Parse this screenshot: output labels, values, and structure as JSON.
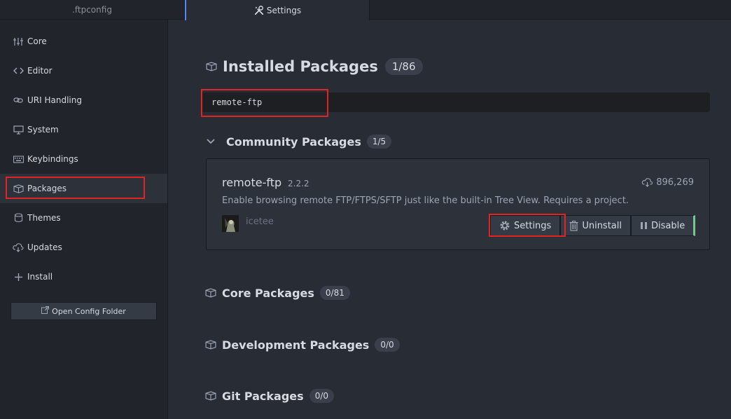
{
  "tabs": [
    {
      "label": ".ftpconfig"
    },
    {
      "label": "Settings"
    }
  ],
  "sidebar": {
    "items": [
      {
        "label": "Core",
        "icon": "sliders-icon"
      },
      {
        "label": "Editor",
        "icon": "code-icon"
      },
      {
        "label": "URI Handling",
        "icon": "link-icon"
      },
      {
        "label": "System",
        "icon": "monitor-icon"
      },
      {
        "label": "Keybindings",
        "icon": "keyboard-icon"
      },
      {
        "label": "Packages",
        "icon": "package-icon"
      },
      {
        "label": "Themes",
        "icon": "paintcan-icon"
      },
      {
        "label": "Updates",
        "icon": "cloud-download-icon"
      },
      {
        "label": "Install",
        "icon": "plus-icon"
      }
    ],
    "active": "Packages",
    "open_config_label": "Open Config Folder"
  },
  "main": {
    "installed_title": "Installed Packages",
    "installed_count": "1/86",
    "search_value": "remote-ftp",
    "community": {
      "title": "Community Packages",
      "count": "1/5"
    },
    "package": {
      "name": "remote-ftp",
      "version": "2.2.2",
      "downloads": "896,269",
      "description": "Enable browsing remote FTP/FTPS/SFTP just like the built-in Tree View. Requires a project.",
      "author": "icetee",
      "buttons": {
        "settings": "Settings",
        "uninstall": "Uninstall",
        "disable": "Disable"
      }
    },
    "core": {
      "title": "Core Packages",
      "count": "0/81"
    },
    "development": {
      "title": "Development Packages",
      "count": "0/0"
    },
    "git": {
      "title": "Git Packages",
      "count": "0/0"
    }
  },
  "colors": {
    "background": "#282c34",
    "sidebar": "#21252b",
    "highlight": "#e02424",
    "enabled": "#73c990"
  }
}
